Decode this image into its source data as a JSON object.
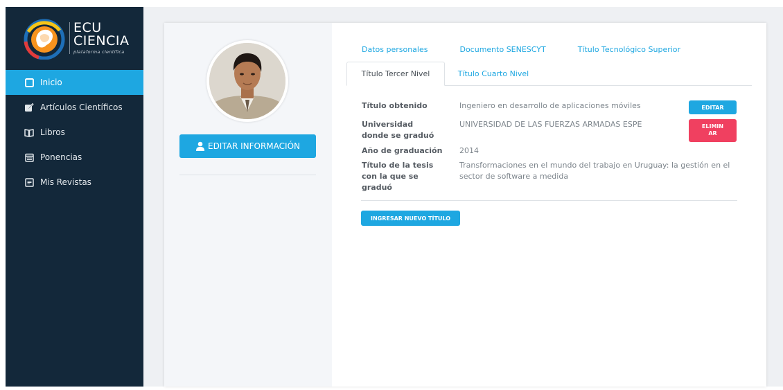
{
  "logo": {
    "line1": "ECU",
    "line2": "CIENCIA",
    "tagline": "plataforma científica"
  },
  "sidebar": {
    "items": [
      {
        "label": "Inicio",
        "icon": "square-icon",
        "active": true
      },
      {
        "label": "Artículos Científicos",
        "icon": "edit-icon",
        "active": false
      },
      {
        "label": "Libros",
        "icon": "book-icon",
        "active": false
      },
      {
        "label": "Ponencias",
        "icon": "calendar-icon",
        "active": false
      },
      {
        "label": "Mis Revistas",
        "icon": "document-icon",
        "active": false
      }
    ]
  },
  "profile": {
    "edit_button": "EDITAR INFORMACIÓN"
  },
  "tabs": {
    "row1": [
      "Datos personales",
      "Documento SENESCYT",
      "Título Tecnológico Superior"
    ],
    "row2": [
      {
        "label": "Título Tercer Nivel",
        "active": true
      },
      {
        "label": "Título Cuarto Nivel",
        "active": false
      }
    ]
  },
  "details": {
    "titulo_label": "Título obtenido",
    "titulo_value": "Ingeniero en desarrollo de aplicaciones móviles",
    "universidad_label": "Universidad donde se graduó",
    "universidad_value": "UNIVERSIDAD DE LAS FUERZAS ARMADAS ESPE",
    "anio_label": "Año de graduación",
    "anio_value": "2014",
    "tesis_label": "Título de la tesis con la que se graduó",
    "tesis_value": "Transformaciones en el mundo del trabajo en Uruguay: la gestión en el sector de software a medida"
  },
  "actions": {
    "editar": "EDITAR",
    "eliminar": "ELIMINAR",
    "nuevo": "INGRESAR NUEVO TÍTULO"
  },
  "colors": {
    "sidebar_bg": "#13283a",
    "accent": "#1ea7e1",
    "danger": "#f04060"
  }
}
